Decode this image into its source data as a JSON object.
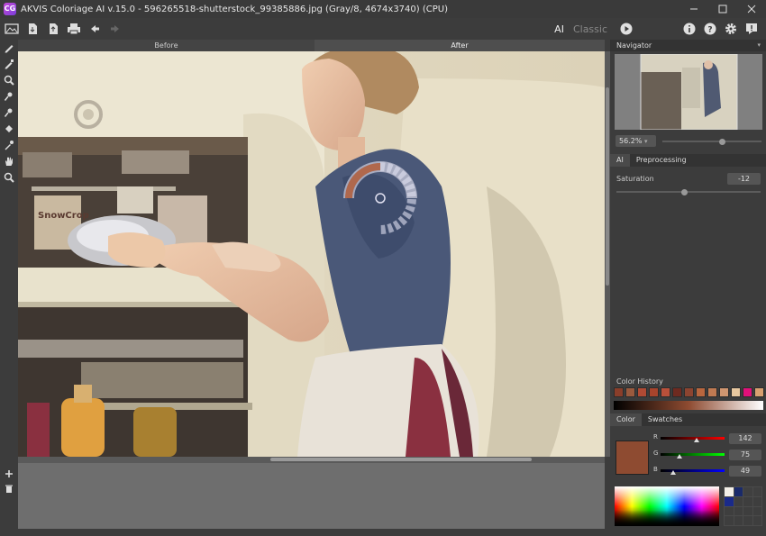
{
  "window": {
    "title": "AKVIS Coloriage AI v.15.0 - 596265518-shutterstock_99385886.jpg (Gray/8, 4674x3740) (CPU)",
    "logo_text": "CG"
  },
  "toolbar": {
    "mode_ai": "AI",
    "mode_classic": "Classic",
    "icons": [
      "open-image-icon",
      "import-icon",
      "export-icon",
      "print-icon",
      "undo-icon",
      "redo-icon"
    ],
    "right_icons": [
      "play-icon",
      "info-icon",
      "help-icon",
      "settings-icon",
      "notifications-icon"
    ]
  },
  "view_tabs": {
    "before": "Before",
    "after": "After"
  },
  "left_tools": [
    "color-pencil-icon",
    "keep-color-pencil-icon",
    "magic-tube-icon",
    "eraser-icon",
    "color-replace-icon",
    "paint-bucket-icon",
    "eyedropper-icon",
    "hand-icon",
    "zoom-icon"
  ],
  "navigator": {
    "title": "Navigator",
    "zoom": "56.2%",
    "zoom_level": 0.6
  },
  "settings_tabs": {
    "ai": "AI",
    "preprocessing": "Preprocessing"
  },
  "saturation": {
    "label": "Saturation",
    "value": "-12",
    "slider_fraction": 0.47
  },
  "color_history": {
    "label": "Color History",
    "swatches": [
      "#8a3e2a",
      "#9a5a3e",
      "#b04a34",
      "#a8442c",
      "#b9503a",
      "#6e2a20",
      "#8c4430",
      "#b8663e",
      "#c07a52",
      "#d09670",
      "#e8c8a0",
      "#e0107a",
      "#d8a070"
    ]
  },
  "color_panel": {
    "tab_color": "Color",
    "tab_swatches": "Swatches",
    "current_color": "#8e4b31",
    "r_label": "R",
    "r_value": "142",
    "g_label": "G",
    "g_value": "75",
    "b_label": "B",
    "b_value": "49"
  },
  "bottom_left": {
    "add_icon": "add-icon",
    "delete_icon": "trash-icon"
  }
}
